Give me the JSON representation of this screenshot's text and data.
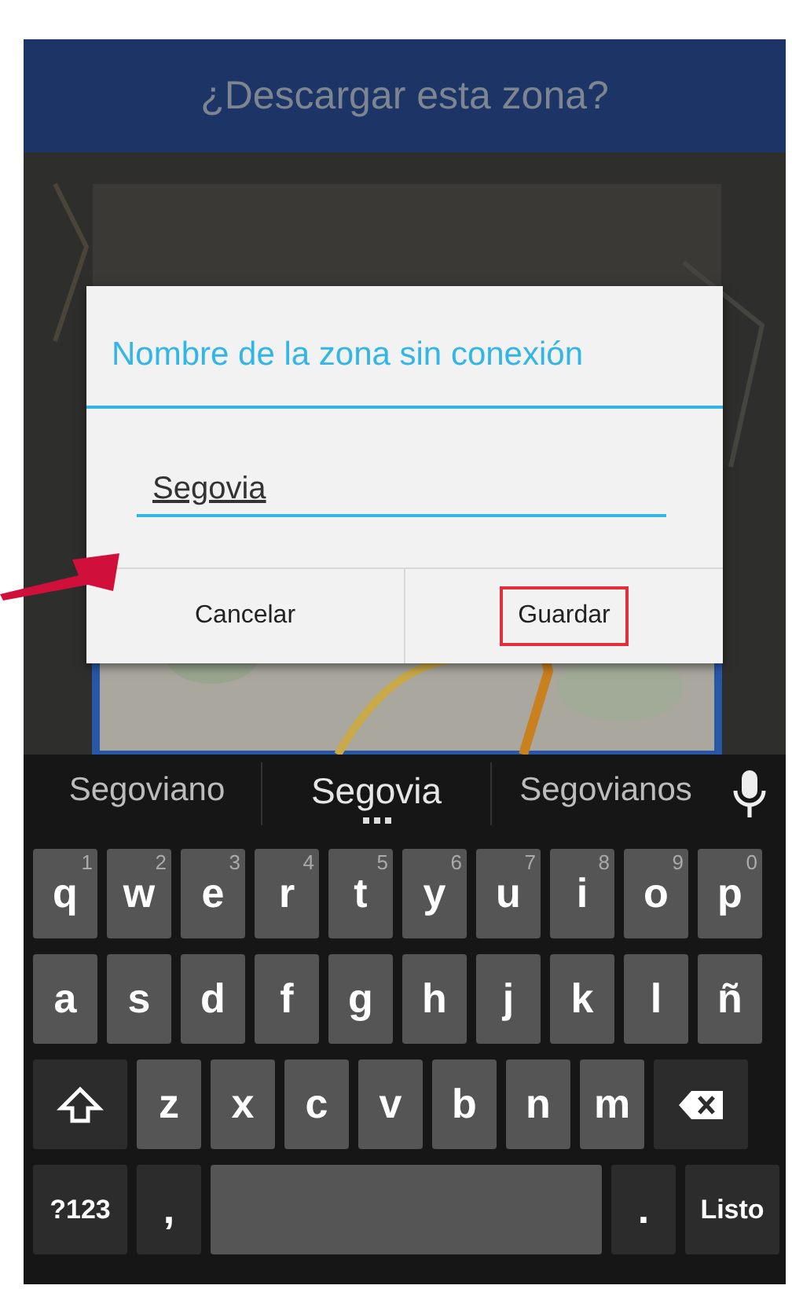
{
  "header": {
    "title": "¿Descargar esta zona?"
  },
  "dialog": {
    "title": "Nombre de la zona sin conexión",
    "name_field": {
      "value": "Segovia"
    },
    "buttons": [
      {
        "label": "Cancelar",
        "highlighted": false
      },
      {
        "label": "Guardar",
        "highlighted": true
      }
    ]
  },
  "keyboard": {
    "suggestions": [
      {
        "text": "Segoviano",
        "selected": false
      },
      {
        "text": "Segovia",
        "selected": true
      },
      {
        "text": "Segovianos",
        "selected": false
      }
    ],
    "key_rows": [
      {
        "keys": [
          {
            "kind": "letter",
            "label": "q",
            "hint": "1"
          },
          {
            "kind": "letter",
            "label": "w",
            "hint": "2"
          },
          {
            "kind": "letter",
            "label": "e",
            "hint": "3"
          },
          {
            "kind": "letter",
            "label": "r",
            "hint": "4"
          },
          {
            "kind": "letter",
            "label": "t",
            "hint": "5"
          },
          {
            "kind": "letter",
            "label": "y",
            "hint": "6"
          },
          {
            "kind": "letter",
            "label": "u",
            "hint": "7"
          },
          {
            "kind": "letter",
            "label": "i",
            "hint": "8"
          },
          {
            "kind": "letter",
            "label": "o",
            "hint": "9"
          },
          {
            "kind": "letter",
            "label": "p",
            "hint": "0"
          }
        ]
      },
      {
        "keys": [
          {
            "kind": "letter",
            "label": "a"
          },
          {
            "kind": "letter",
            "label": "s"
          },
          {
            "kind": "letter",
            "label": "d"
          },
          {
            "kind": "letter",
            "label": "f"
          },
          {
            "kind": "letter",
            "label": "g"
          },
          {
            "kind": "letter",
            "label": "h"
          },
          {
            "kind": "letter",
            "label": "j"
          },
          {
            "kind": "letter",
            "label": "k"
          },
          {
            "kind": "letter",
            "label": "l"
          },
          {
            "kind": "letter",
            "label": "ñ"
          }
        ]
      },
      {
        "keys": [
          {
            "kind": "shift"
          },
          {
            "kind": "letter",
            "label": "z"
          },
          {
            "kind": "letter",
            "label": "x"
          },
          {
            "kind": "letter",
            "label": "c"
          },
          {
            "kind": "letter",
            "label": "v"
          },
          {
            "kind": "letter",
            "label": "b"
          },
          {
            "kind": "letter",
            "label": "n"
          },
          {
            "kind": "letter",
            "label": "m"
          },
          {
            "kind": "delete"
          }
        ]
      },
      {
        "keys": [
          {
            "kind": "symbols",
            "label": "?123"
          },
          {
            "kind": "punct",
            "label": ","
          },
          {
            "kind": "space"
          },
          {
            "kind": "punct",
            "label": "."
          },
          {
            "kind": "done",
            "label": "Listo"
          }
        ]
      }
    ]
  }
}
